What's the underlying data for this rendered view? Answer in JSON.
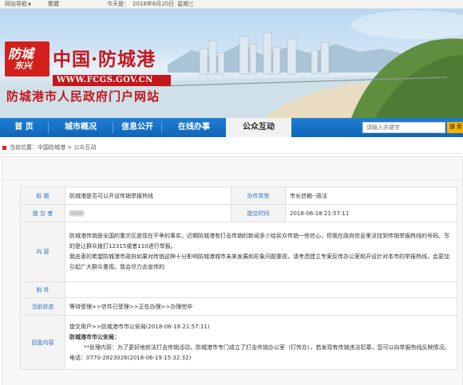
{
  "topbar": {
    "site_nav": "网站导航",
    "traditional": "繁體",
    "date_label": "今天是：",
    "date_value": "2018年6月20日",
    "weekday": "星期三"
  },
  "header": {
    "logo_line1": "防城",
    "logo_line2": "东兴",
    "site_title": "中国·防城港",
    "url": "WWW.FCGS.GOV.CN",
    "subtitle": "防城港市人民政府门户网站"
  },
  "nav": {
    "items": [
      {
        "label": "首 页"
      },
      {
        "label": "城市概况"
      },
      {
        "label": "信息公开"
      },
      {
        "label": "在线办事"
      },
      {
        "label": "公众互动"
      }
    ],
    "search_placeholder": "请输入关键字",
    "search_button": "搜 索"
  },
  "breadcrumb": {
    "prefix": "当前位置：",
    "home": "中国防城港",
    "sep": " > ",
    "current": "公众互动"
  },
  "detail": {
    "title_label": "标    题",
    "title_value": "防城港是否可以开设传销举报热线",
    "type_label": "办件类型",
    "type_value": "市长信箱--政法",
    "submitter_label": "提 交 者",
    "time_label": "提交时间",
    "time_value": "2018-06-18 21:57:11",
    "content_label": "内    容",
    "content_p1": "防城港传销是全国的重灾区是现在不争的事实，近期防城港有打击传销的新闻多少给民众传销一些信心，但我在政府信息里没找到传销举报热线的号码。写的是让群众拨打12315或者110进行举报。",
    "content_p2": "我由衷的希望防城港市政府如果对传销这种十分影响防城港城市未来发展和形象问题重视，请考虑建立专案反传办公室和开设针对本市的举报热线，会更加引起广大群众重视。我会尽力去宣传的",
    "attachment_label": "附    件",
    "attachment_value": "",
    "status_label": "当前状态",
    "status_value": "等待受理>>信件已受理>>正在办理>>办理完毕",
    "reply_label": "回复内容",
    "reply_line1": "提交用户>>防城港市市公安局(2018-06-18 21:57:11)",
    "reply_line2": "防城港市市公安局：",
    "reply_line3": "**处理内容：为了更好地依法打击传销活动，防城港市专门成立了打击传销办公室（打传办），若发现有传销违法犯罪，您可以向举报热线反映情况。电话：0770-2823026(2018-06-19 15:32:32)"
  },
  "colors": {
    "nav_blue": "#1272c8",
    "brand_red": "#c4161c",
    "label_blue": "#2d6fc0",
    "search_yellow": "#f6b400"
  }
}
